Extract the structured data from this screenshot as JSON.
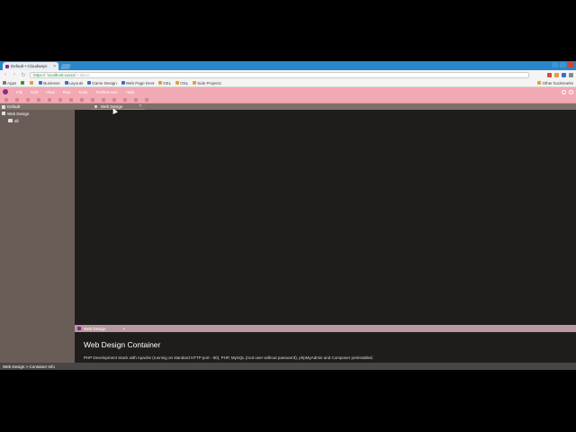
{
  "browser": {
    "tab_title": "Default • Cloudways",
    "tab_close": "×",
    "nav": {
      "back": "‹",
      "forward": "›",
      "reload": "↻"
    },
    "omnibox": {
      "secure": "https://",
      "url": "localhost:xxxxx/",
      "hint": "• ideco"
    },
    "bookmarks": [
      {
        "label": "Apps",
        "color": "#777777"
      },
      {
        "label": "",
        "color": "#3d8a3d"
      },
      {
        "label": "",
        "color": "#e0a03b"
      },
      {
        "label": "Business",
        "color": "#3b6fc9"
      },
      {
        "label": "Layouts",
        "color": "#3b6fc9"
      },
      {
        "label": "Game Design",
        "color": "#3b6fc9"
      },
      {
        "label": "Web Page Devt",
        "color": "#3b6fc9"
      },
      {
        "label": "GEL",
        "color": "#e0a03b"
      },
      {
        "label": "OSL",
        "color": "#e0a03b"
      },
      {
        "label": "Side Projects",
        "color": "#e0a03b"
      }
    ],
    "other_bookmarks": "Other bookmarks"
  },
  "app": {
    "menu": [
      "File",
      "Edit",
      "View",
      "Run",
      "Tools",
      "Preferences",
      "Help"
    ],
    "sidebar": {
      "header": "Default",
      "items": [
        {
          "label": "Web Design"
        },
        {
          "label": "all"
        }
      ]
    },
    "main_tab": {
      "label": "Web Design",
      "close": "×"
    },
    "panel": {
      "tab_label": "Web Design",
      "tab_close": "×",
      "title": "Web Design Container",
      "description": "PHP Development Stack with Apache (running on standard HTTP port - 80), PHP, MySQL (root user without password), phpMyAdmin and Composer preinstalled."
    },
    "statusbar": "Web Design > Container Info"
  },
  "colors": {
    "accent": "#8b2a8e",
    "menubar": "#f1a9b4",
    "sidebar": "#6a5d57",
    "editor_bg": "#1f1c1c",
    "chrome_blue": "#2a86c9"
  }
}
